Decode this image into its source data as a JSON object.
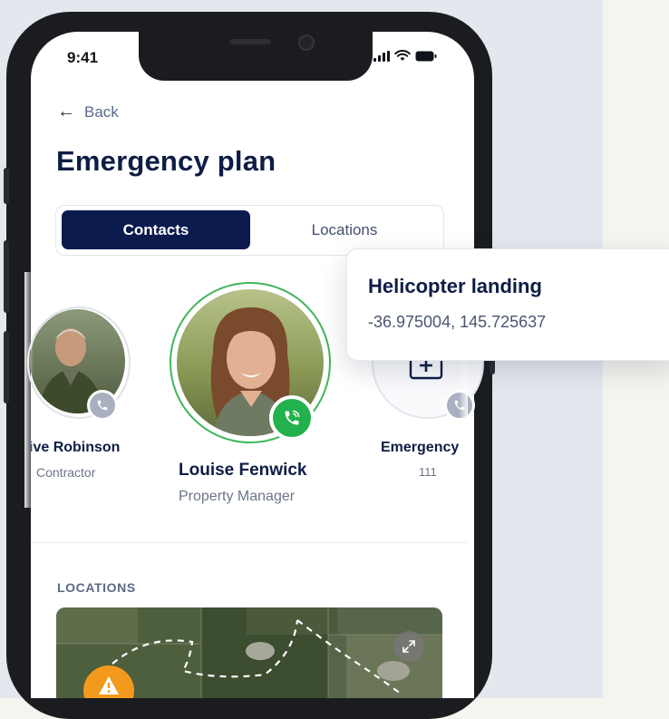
{
  "status_bar": {
    "time": "9:41",
    "icons": [
      "signal-icon",
      "wifi-icon",
      "battery-icon"
    ]
  },
  "header": {
    "back_label": "Back",
    "title": "Emergency plan"
  },
  "tabs": [
    {
      "label": "Contacts",
      "active": true
    },
    {
      "label": "Locations",
      "active": false
    }
  ],
  "contacts": [
    {
      "name": "ive Robinson",
      "role": "Contractor",
      "call_icon": "phone-icon"
    },
    {
      "name": "Louise Fenwick",
      "role": "Property Manager",
      "call_icon": "phone-icon",
      "selected": true
    },
    {
      "name": "Emergency",
      "role": "111",
      "icon": "hospital-icon",
      "call_icon": "phone-icon"
    }
  ],
  "locations": {
    "section_label": "LOCATIONS",
    "expand_icon": "expand-icon",
    "marker_icon": "warning-icon"
  },
  "popup": {
    "title": "Helicopter landing",
    "coords": "-36.975004, 145.725637"
  },
  "colors": {
    "navy": "#0b1b4d",
    "call_green": "#22b14c",
    "ring_green": "#3fb65a",
    "marker_orange": "#f39a1c"
  }
}
